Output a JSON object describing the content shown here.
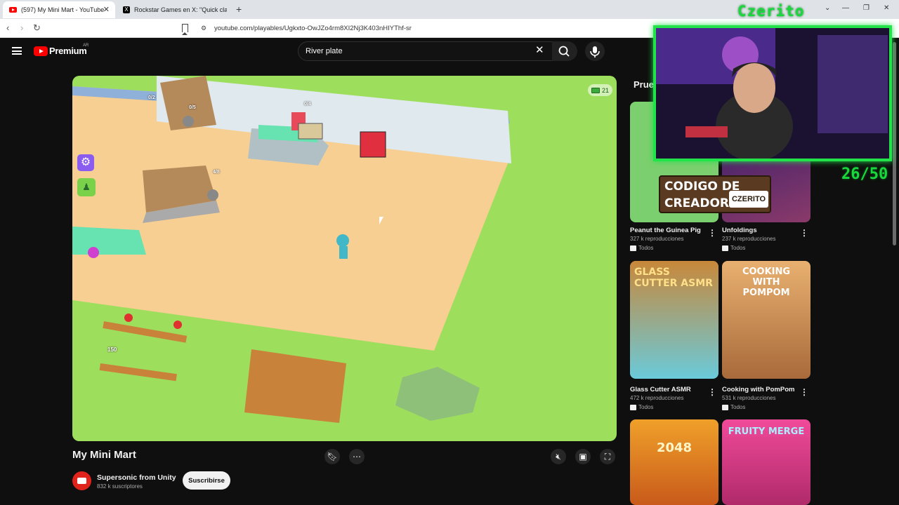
{
  "browser": {
    "tabs": [
      {
        "title": "(597) My Mini Mart - YouTube",
        "active": true,
        "icon": "youtube-icon"
      },
      {
        "title": "Rockstar Games en X: \"Quick clarifica",
        "active": false,
        "icon": "x-icon"
      }
    ],
    "url": "youtube.com/playables/Ugkxto-OwJZo4rm8XI2Nj3K403nHIYThf-sr"
  },
  "header": {
    "logo_text": "Premium",
    "region": "AR",
    "search_value": "River plate"
  },
  "game": {
    "money": "21",
    "price_label": "150",
    "counter_a": "0/4",
    "counter_b": "4/8",
    "counter_c": "0/2",
    "counter_d": "0/5"
  },
  "video": {
    "title": "My Mini Mart",
    "channel": "Supersonic from Unity",
    "subscribers": "832 k suscriptores",
    "subscribe_label": "Suscribirse"
  },
  "sidebar": {
    "heading": "Prueb",
    "cards": [
      {
        "title": "Peanut the Guinea Pig",
        "views": "327 k reproducciones",
        "tag": "Todos",
        "art": "P",
        "bg": "#7ccf6e"
      },
      {
        "title": "Unfoldings",
        "views": "237 k reproducciones",
        "tag": "Todos",
        "art": "",
        "bg": "#3a2a7a"
      },
      {
        "title": "Glass Cutter ASMR",
        "views": "472 k reproducciones",
        "tag": "Todos",
        "art": "GLASS CUTTER ASMR",
        "bg": "#c88a3a"
      },
      {
        "title": "Cooking with PomPom",
        "views": "531 k reproducciones",
        "tag": "Todos",
        "art": "COOKING WITH POMPOM",
        "bg": "#e8a85a"
      },
      {
        "title": "",
        "views": "",
        "tag": "",
        "art": "2048",
        "bg": "#f08a2a"
      },
      {
        "title": "",
        "views": "",
        "tag": "",
        "art": "FRUITY MERGE",
        "bg": "#e83a8a"
      }
    ]
  },
  "overlay": {
    "streamer": "Czerito",
    "counter": "26/50",
    "promo_text": "CODIGO DE CREADOR",
    "promo_name": "CZERITO"
  }
}
